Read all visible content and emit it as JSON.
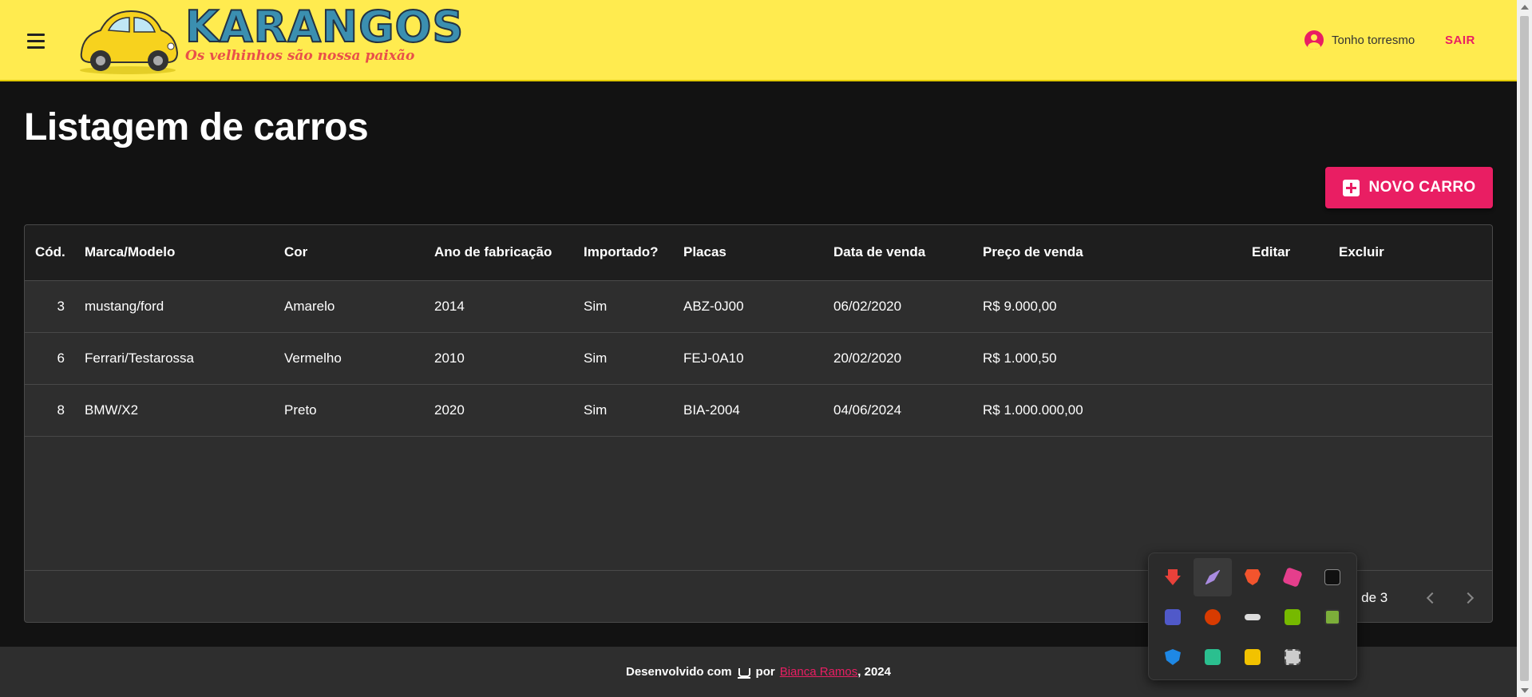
{
  "header": {
    "logo_title": "KARANGOS",
    "logo_subtitle": "Os velhinhos são nossa paixão",
    "user_name": "Tonho torresmo",
    "logout_label": "SAIR"
  },
  "page": {
    "title": "Listagem de carros",
    "new_button_label": "NOVO CARRO"
  },
  "table": {
    "columns": [
      "Cód.",
      "Marca/Modelo",
      "Cor",
      "Ano de fabricação",
      "Importado?",
      "Placas",
      "Data de venda",
      "Preço de venda",
      "Editar",
      "Excluir"
    ],
    "rows": [
      {
        "id": "3",
        "model": "mustang/ford",
        "color": "Amarelo",
        "year": "2014",
        "imported": "Sim",
        "plate": "ABZ-0J00",
        "sale_date": "06/02/2020",
        "price": "R$ 9.000,00"
      },
      {
        "id": "6",
        "model": "Ferrari/Testarossa",
        "color": "Vermelho",
        "year": "2010",
        "imported": "Sim",
        "plate": "FEJ-0A10",
        "sale_date": "20/02/2020",
        "price": "R$ 1.000,50"
      },
      {
        "id": "8",
        "model": "BMW/X2",
        "color": "Preto",
        "year": "2020",
        "imported": "Sim",
        "plate": "BIA-2004",
        "sale_date": "04/06/2024",
        "price": "R$ 1.000.000,00"
      }
    ],
    "pagination_text": "3 de 3"
  },
  "footer": {
    "prefix": "Desenvolvido com",
    "by": "por",
    "author": "Bianca Ramos",
    "year_suffix": ", 2024"
  },
  "tray": {
    "icons": [
      {
        "name": "download-arrow-icon",
        "color": "#e8413a"
      },
      {
        "name": "feather-icon",
        "color": "#a98be0"
      },
      {
        "name": "brave-icon",
        "color": "#f2542d"
      },
      {
        "name": "cube-icon",
        "color": "#e53e8c"
      },
      {
        "name": "epic-games-icon",
        "color": "#111111"
      },
      {
        "name": "teams-icon",
        "color": "#5059c9"
      },
      {
        "name": "office-icon",
        "color": "#d83b01"
      },
      {
        "name": "usb-icon",
        "color": "#dddddd"
      },
      {
        "name": "nvidia-icon",
        "color": "#76b900"
      },
      {
        "name": "grid-app-icon",
        "color": "#7cae3a"
      },
      {
        "name": "defender-icon",
        "color": "#1e88e5"
      },
      {
        "name": "wallet-icon",
        "color": "#2bbf8f"
      },
      {
        "name": "lock-app-icon",
        "color": "#f2c200"
      },
      {
        "name": "chip-icon",
        "color": "#cccccc"
      }
    ]
  }
}
